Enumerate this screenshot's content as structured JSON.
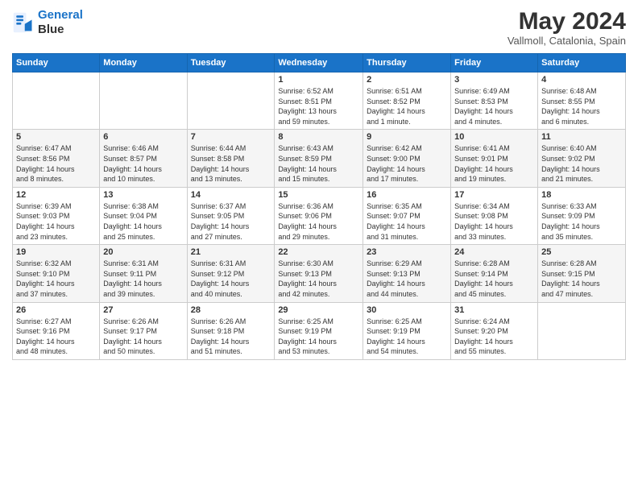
{
  "logo": {
    "line1": "General",
    "line2": "Blue"
  },
  "title": "May 2024",
  "location": "Vallmoll, Catalonia, Spain",
  "weekdays": [
    "Sunday",
    "Monday",
    "Tuesday",
    "Wednesday",
    "Thursday",
    "Friday",
    "Saturday"
  ],
  "weeks": [
    [
      {
        "num": "",
        "info": ""
      },
      {
        "num": "",
        "info": ""
      },
      {
        "num": "",
        "info": ""
      },
      {
        "num": "1",
        "info": "Sunrise: 6:52 AM\nSunset: 8:51 PM\nDaylight: 13 hours\nand 59 minutes."
      },
      {
        "num": "2",
        "info": "Sunrise: 6:51 AM\nSunset: 8:52 PM\nDaylight: 14 hours\nand 1 minute."
      },
      {
        "num": "3",
        "info": "Sunrise: 6:49 AM\nSunset: 8:53 PM\nDaylight: 14 hours\nand 4 minutes."
      },
      {
        "num": "4",
        "info": "Sunrise: 6:48 AM\nSunset: 8:55 PM\nDaylight: 14 hours\nand 6 minutes."
      }
    ],
    [
      {
        "num": "5",
        "info": "Sunrise: 6:47 AM\nSunset: 8:56 PM\nDaylight: 14 hours\nand 8 minutes."
      },
      {
        "num": "6",
        "info": "Sunrise: 6:46 AM\nSunset: 8:57 PM\nDaylight: 14 hours\nand 10 minutes."
      },
      {
        "num": "7",
        "info": "Sunrise: 6:44 AM\nSunset: 8:58 PM\nDaylight: 14 hours\nand 13 minutes."
      },
      {
        "num": "8",
        "info": "Sunrise: 6:43 AM\nSunset: 8:59 PM\nDaylight: 14 hours\nand 15 minutes."
      },
      {
        "num": "9",
        "info": "Sunrise: 6:42 AM\nSunset: 9:00 PM\nDaylight: 14 hours\nand 17 minutes."
      },
      {
        "num": "10",
        "info": "Sunrise: 6:41 AM\nSunset: 9:01 PM\nDaylight: 14 hours\nand 19 minutes."
      },
      {
        "num": "11",
        "info": "Sunrise: 6:40 AM\nSunset: 9:02 PM\nDaylight: 14 hours\nand 21 minutes."
      }
    ],
    [
      {
        "num": "12",
        "info": "Sunrise: 6:39 AM\nSunset: 9:03 PM\nDaylight: 14 hours\nand 23 minutes."
      },
      {
        "num": "13",
        "info": "Sunrise: 6:38 AM\nSunset: 9:04 PM\nDaylight: 14 hours\nand 25 minutes."
      },
      {
        "num": "14",
        "info": "Sunrise: 6:37 AM\nSunset: 9:05 PM\nDaylight: 14 hours\nand 27 minutes."
      },
      {
        "num": "15",
        "info": "Sunrise: 6:36 AM\nSunset: 9:06 PM\nDaylight: 14 hours\nand 29 minutes."
      },
      {
        "num": "16",
        "info": "Sunrise: 6:35 AM\nSunset: 9:07 PM\nDaylight: 14 hours\nand 31 minutes."
      },
      {
        "num": "17",
        "info": "Sunrise: 6:34 AM\nSunset: 9:08 PM\nDaylight: 14 hours\nand 33 minutes."
      },
      {
        "num": "18",
        "info": "Sunrise: 6:33 AM\nSunset: 9:09 PM\nDaylight: 14 hours\nand 35 minutes."
      }
    ],
    [
      {
        "num": "19",
        "info": "Sunrise: 6:32 AM\nSunset: 9:10 PM\nDaylight: 14 hours\nand 37 minutes."
      },
      {
        "num": "20",
        "info": "Sunrise: 6:31 AM\nSunset: 9:11 PM\nDaylight: 14 hours\nand 39 minutes."
      },
      {
        "num": "21",
        "info": "Sunrise: 6:31 AM\nSunset: 9:12 PM\nDaylight: 14 hours\nand 40 minutes."
      },
      {
        "num": "22",
        "info": "Sunrise: 6:30 AM\nSunset: 9:13 PM\nDaylight: 14 hours\nand 42 minutes."
      },
      {
        "num": "23",
        "info": "Sunrise: 6:29 AM\nSunset: 9:13 PM\nDaylight: 14 hours\nand 44 minutes."
      },
      {
        "num": "24",
        "info": "Sunrise: 6:28 AM\nSunset: 9:14 PM\nDaylight: 14 hours\nand 45 minutes."
      },
      {
        "num": "25",
        "info": "Sunrise: 6:28 AM\nSunset: 9:15 PM\nDaylight: 14 hours\nand 47 minutes."
      }
    ],
    [
      {
        "num": "26",
        "info": "Sunrise: 6:27 AM\nSunset: 9:16 PM\nDaylight: 14 hours\nand 48 minutes."
      },
      {
        "num": "27",
        "info": "Sunrise: 6:26 AM\nSunset: 9:17 PM\nDaylight: 14 hours\nand 50 minutes."
      },
      {
        "num": "28",
        "info": "Sunrise: 6:26 AM\nSunset: 9:18 PM\nDaylight: 14 hours\nand 51 minutes."
      },
      {
        "num": "29",
        "info": "Sunrise: 6:25 AM\nSunset: 9:19 PM\nDaylight: 14 hours\nand 53 minutes."
      },
      {
        "num": "30",
        "info": "Sunrise: 6:25 AM\nSunset: 9:19 PM\nDaylight: 14 hours\nand 54 minutes."
      },
      {
        "num": "31",
        "info": "Sunrise: 6:24 AM\nSunset: 9:20 PM\nDaylight: 14 hours\nand 55 minutes."
      },
      {
        "num": "",
        "info": ""
      }
    ]
  ]
}
